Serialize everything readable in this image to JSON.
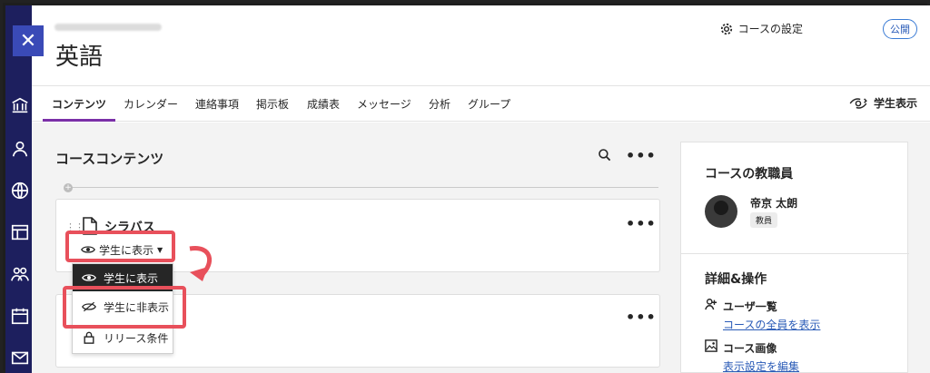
{
  "page": {
    "title": "英語",
    "settings_label": "コースの設定",
    "status_badge": "公開"
  },
  "tabs": [
    {
      "label": "コンテンツ"
    },
    {
      "label": "カレンダー"
    },
    {
      "label": "連絡事項"
    },
    {
      "label": "掲示板"
    },
    {
      "label": "成績表"
    },
    {
      "label": "メッセージ"
    },
    {
      "label": "分析"
    },
    {
      "label": "グループ"
    }
  ],
  "student_view_label": "学生表示",
  "content": {
    "section_title": "コースコンテンツ",
    "items": [
      {
        "title": "シラバス",
        "visibility": "学生に表示"
      }
    ],
    "visibility_menu": [
      {
        "label": "学生に表示"
      },
      {
        "label": "学生に非表示"
      },
      {
        "label": "リリース条件"
      }
    ]
  },
  "sidebar": {
    "staff_heading": "コースの教職員",
    "staff_name": "帝京 太朗",
    "staff_role": "教員",
    "details_heading": "詳細&操作",
    "links": [
      {
        "heading": "ユーザ一覧",
        "link": "コースの全員を表示"
      },
      {
        "heading": "コース画像",
        "link": "表示設定を編集"
      }
    ]
  },
  "colors": {
    "rail": "#1d1f5e",
    "accent_tab": "#7a2fa7",
    "highlight_box": "#e8505b",
    "link": "#2a5bb7"
  }
}
